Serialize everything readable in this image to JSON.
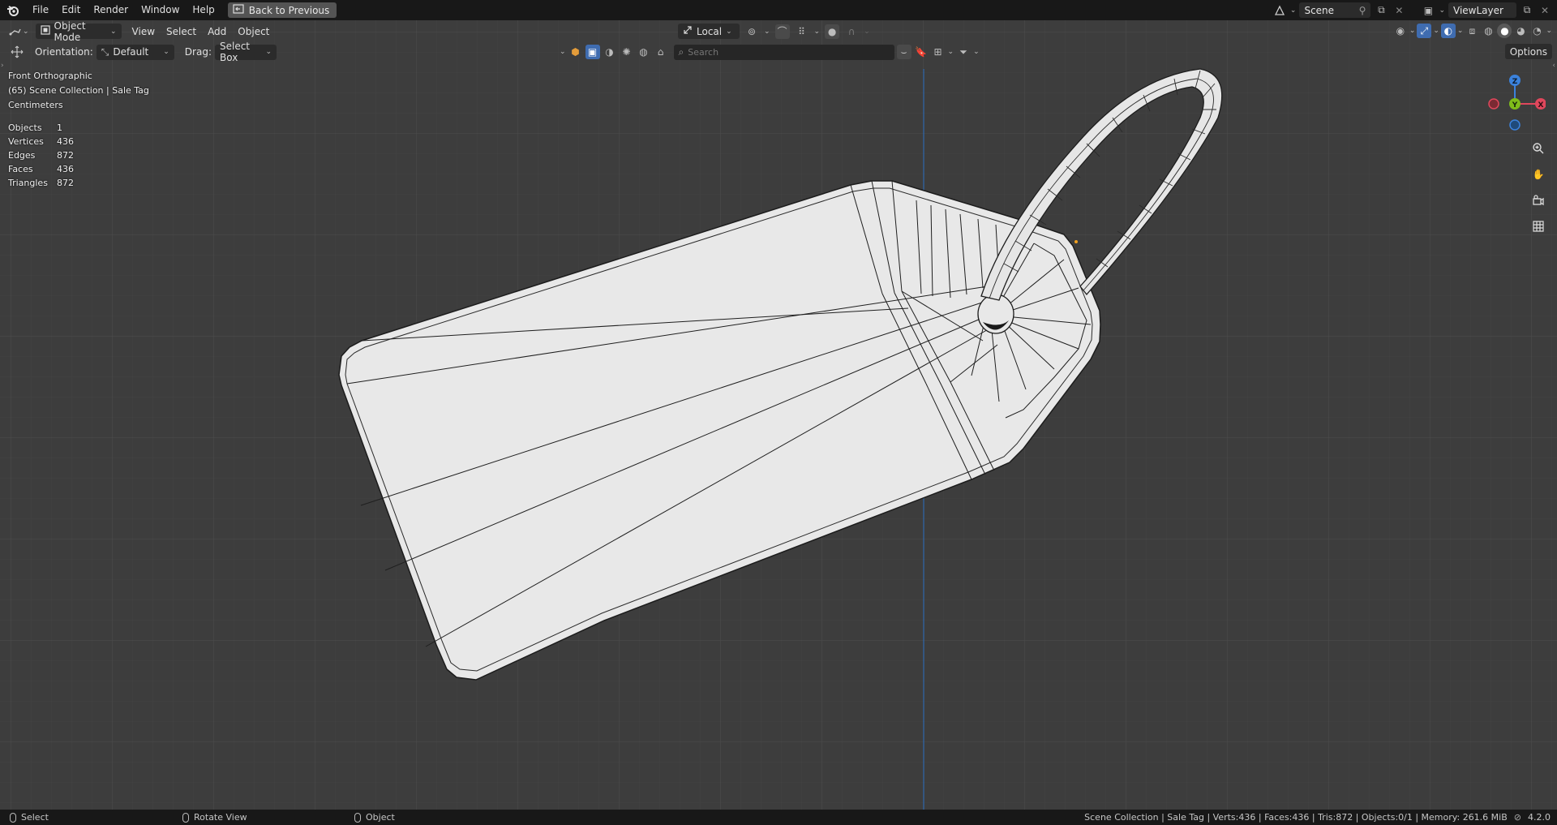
{
  "menu": {
    "items": [
      "File",
      "Edit",
      "Render",
      "Window",
      "Help"
    ],
    "back_label": "Back to Previous"
  },
  "top_right": {
    "scene": "Scene",
    "view_layer": "ViewLayer"
  },
  "header": {
    "mode": "Object Mode",
    "menus": [
      "View",
      "Select",
      "Add",
      "Object"
    ],
    "transform_space": "Local",
    "options_label": "Options"
  },
  "toolbar2": {
    "orientation_label": "Orientation:",
    "orientation_value": "Default",
    "drag_label": "Drag:",
    "drag_value": "Select Box",
    "search_placeholder": "Search"
  },
  "overlay": {
    "view_name": "Front Orthographic",
    "collection": "(65) Scene Collection | Sale Tag",
    "units": "Centimeters"
  },
  "stats": [
    {
      "label": "Objects",
      "value": "1"
    },
    {
      "label": "Vertices",
      "value": "436"
    },
    {
      "label": "Edges",
      "value": "872"
    },
    {
      "label": "Faces",
      "value": "436"
    },
    {
      "label": "Triangles",
      "value": "872"
    }
  ],
  "gizmo": {
    "z": "Z",
    "y": "Y",
    "x": "X"
  },
  "statusbar": {
    "select": "Select",
    "rotate": "Rotate View",
    "object": "Object",
    "info": "Scene Collection | Sale Tag | Verts:436 | Faces:436 | Tris:872 | Objects:0/1 | Memory: 261.6 MiB",
    "version": "4.2.0"
  },
  "colors": {
    "viewport_bg": "#3d3d3d",
    "mesh_fill": "#e8e8e8",
    "wire": "#1a1a1a",
    "axis_blue": "#2b6fc1",
    "gizmo_x": "#e0475c",
    "gizmo_y": "#7fbc1a",
    "gizmo_z": "#3b82dc"
  }
}
